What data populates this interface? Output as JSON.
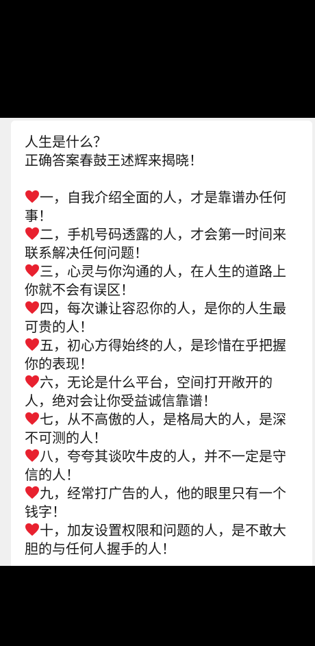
{
  "intro": {
    "line1": "人生是什么？",
    "line2": "正确答案春鼓王述辉来揭晓！"
  },
  "accent_color": "#e8212f",
  "icon": "red-heart-icon",
  "items": [
    {
      "line1": "一，自我介绍全面的人，才是靠谱办任何",
      "line2": "事！"
    },
    {
      "line1": "二，手机号码透露的人，才会第一时间来",
      "line2": "联系解决任何问题！"
    },
    {
      "line1": "三，心灵与你沟通的人，在人生的道路上",
      "line2": "你就不会有误区！"
    },
    {
      "line1": "四，每次谦让容忍你的人，是你的人生最",
      "line2": "可贵的人！"
    },
    {
      "line1": "五，初心方得始终的人，是珍惜在乎把握",
      "line2": "你的表现！"
    },
    {
      "line1": "六，无论是什么平台，空间打开敞开的",
      "line2": "人，绝对会让你受益诚信靠谱！"
    },
    {
      "line1": "七，从不高傲的人，是格局大的人，是深",
      "line2": "不可测的人！"
    },
    {
      "line1": "八，夸夸其谈吹牛皮的人，并不一定是守",
      "line2": "信的人！"
    },
    {
      "line1": "九，经常打广告的人，他的眼里只有一个",
      "line2": "钱字！"
    },
    {
      "line1": "十，加友设置权限和问题的人，是不敢大",
      "line2": "胆的与任何人握手的人！"
    }
  ]
}
